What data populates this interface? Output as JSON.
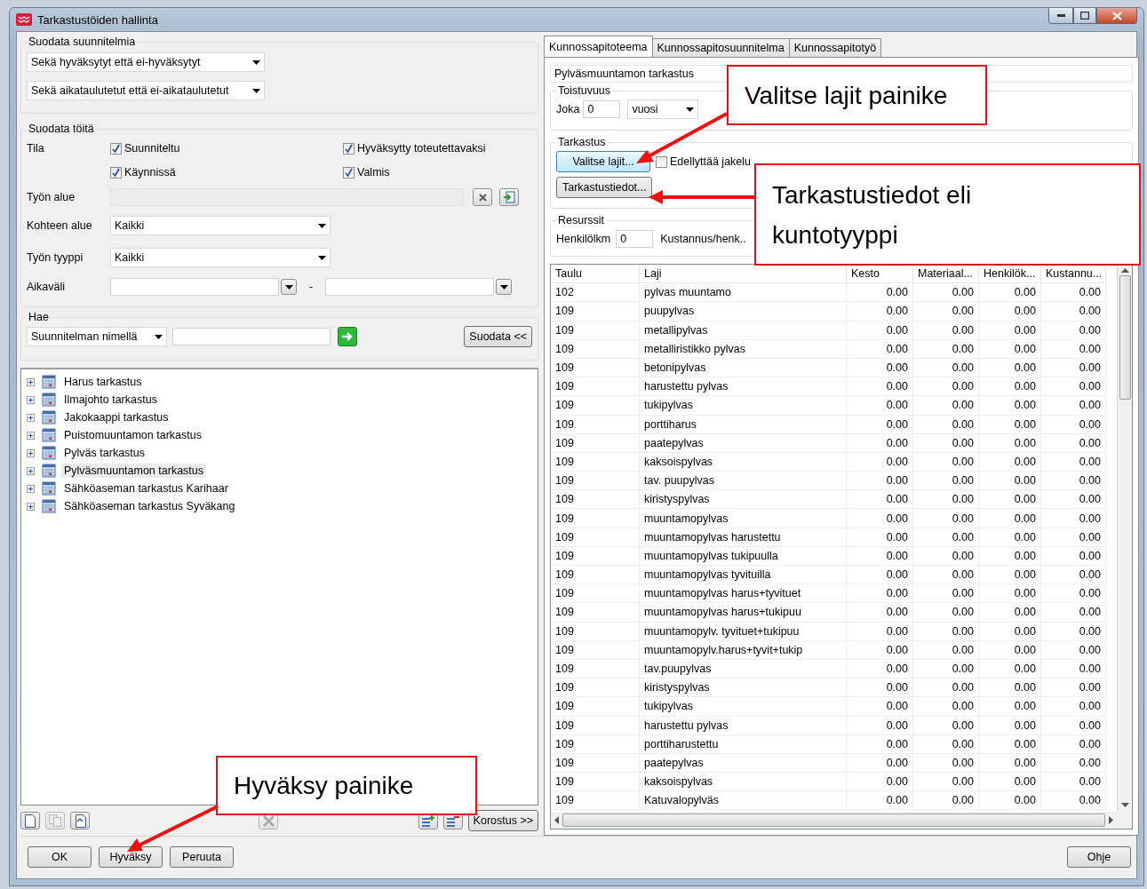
{
  "window": {
    "title": "Tarkastustöiden hallinta"
  },
  "plan_filter": {
    "title": "Suodata suunnitelmia",
    "approval": "Sekä hyväksytyt että ei-hyväksytyt",
    "schedule": "Sekä aikataulutetut että ei-aikataulutetut"
  },
  "work_filter": {
    "title": "Suodata töitä",
    "status_label": "Tila",
    "statuses": [
      {
        "label": "Suunniteltu",
        "checked": true
      },
      {
        "label": "Hyväksytty toteutettavaksi",
        "checked": true
      },
      {
        "label": "Käynnissä",
        "checked": true
      },
      {
        "label": "Valmis",
        "checked": true
      }
    ],
    "area_label": "Työn alue",
    "target_area_label": "Kohteen alue",
    "target_area": "Kaikki",
    "type_label": "Työn tyyppi",
    "type": "Kaikki",
    "period_label": "Aikaväli",
    "period_separator": "-"
  },
  "search": {
    "title": "Hae",
    "mode": "Suunnitelman nimellä",
    "filter_button": "Suodata <<"
  },
  "tree": [
    {
      "label": "Harus tarkastus",
      "selected": false,
      "expanded": false
    },
    {
      "label": "Ilmajohto tarkastus",
      "selected": false,
      "expanded": false
    },
    {
      "label": "Jakokaappi tarkastus",
      "selected": false,
      "expanded": false
    },
    {
      "label": "Puistomuuntamon tarkastus",
      "selected": false,
      "expanded": false
    },
    {
      "label": "Pylväs tarkastus",
      "selected": false,
      "expanded": false
    },
    {
      "label": "Pylväsmuuntamon tarkastus",
      "selected": true,
      "expanded": false
    },
    {
      "label": "Sähköaseman tarkastus Karihaar",
      "selected": false,
      "expanded": false
    },
    {
      "label": "Sähköaseman tarkastus Syväkang",
      "selected": false,
      "expanded": false
    }
  ],
  "toolbar": {
    "highlight_button": "Korostus >>"
  },
  "tabs": [
    {
      "label": "Kunnossapitoteema",
      "selected": true
    },
    {
      "label": "Kunnossapitosuunnitelma",
      "selected": false
    },
    {
      "label": "Kunnossapitotyö",
      "selected": false
    }
  ],
  "theme": {
    "name": "Pylväsmuuntamon tarkastus",
    "recurrence": {
      "title": "Toistuvuus",
      "every_label": "Joka",
      "every": "0",
      "unit": "vuosi"
    },
    "inspection": {
      "title": "Tarkastus",
      "buttons": [
        {
          "label": "Valitse lajit...",
          "focused": true
        },
        {
          "label": "Tarkastustiedot...",
          "focused": false
        }
      ],
      "checkbox": {
        "label": "Edellyttää jakelu",
        "checked": false
      }
    },
    "resources": {
      "title": "Resurssit",
      "persons_label": "Henkilölkm",
      "persons": "0",
      "cost_label": "Kustannus/henk.."
    }
  },
  "table": {
    "columns": [
      "Taulu",
      "Laji",
      "Kesto",
      "Materiaal...",
      "Henkilök...",
      "Kustannu..."
    ],
    "rows": [
      [
        "102",
        "pylvas muuntamo",
        "0.00",
        "0.00",
        "0.00",
        "0.00"
      ],
      [
        "109",
        "puupylvas",
        "0.00",
        "0.00",
        "0.00",
        "0.00"
      ],
      [
        "109",
        "metallipylvas",
        "0.00",
        "0.00",
        "0.00",
        "0.00"
      ],
      [
        "109",
        "metalliristikko pylvas",
        "0.00",
        "0.00",
        "0.00",
        "0.00"
      ],
      [
        "109",
        "betonipylvas",
        "0.00",
        "0.00",
        "0.00",
        "0.00"
      ],
      [
        "109",
        "harustettu pylvas",
        "0.00",
        "0.00",
        "0.00",
        "0.00"
      ],
      [
        "109",
        "tukipylvas",
        "0.00",
        "0.00",
        "0.00",
        "0.00"
      ],
      [
        "109",
        "porttiharus",
        "0.00",
        "0.00",
        "0.00",
        "0.00"
      ],
      [
        "109",
        "paatepylvas",
        "0.00",
        "0.00",
        "0.00",
        "0.00"
      ],
      [
        "109",
        "kaksoispylvas",
        "0.00",
        "0.00",
        "0.00",
        "0.00"
      ],
      [
        "109",
        "tav. puupylvas",
        "0.00",
        "0.00",
        "0.00",
        "0.00"
      ],
      [
        "109",
        "kiristyspylvas",
        "0.00",
        "0.00",
        "0.00",
        "0.00"
      ],
      [
        "109",
        "muuntamopylvas",
        "0.00",
        "0.00",
        "0.00",
        "0.00"
      ],
      [
        "109",
        "muuntamopylvas harustettu",
        "0.00",
        "0.00",
        "0.00",
        "0.00"
      ],
      [
        "109",
        "muuntamopylvas tukipuulla",
        "0.00",
        "0.00",
        "0.00",
        "0.00"
      ],
      [
        "109",
        "muuntamopylvas tyvituilla",
        "0.00",
        "0.00",
        "0.00",
        "0.00"
      ],
      [
        "109",
        "muuntamopylvas harus+tyvituet",
        "0.00",
        "0.00",
        "0.00",
        "0.00"
      ],
      [
        "109",
        "muuntamopylvas harus+tukipuu",
        "0.00",
        "0.00",
        "0.00",
        "0.00"
      ],
      [
        "109",
        "muuntamopylv. tyvituet+tukipuu",
        "0.00",
        "0.00",
        "0.00",
        "0.00"
      ],
      [
        "109",
        "muuntamopylv.harus+tyvit+tukip",
        "0.00",
        "0.00",
        "0.00",
        "0.00"
      ],
      [
        "109",
        "tav.puupylvas",
        "0.00",
        "0.00",
        "0.00",
        "0.00"
      ],
      [
        "109",
        "kiristyspylvas",
        "0.00",
        "0.00",
        "0.00",
        "0.00"
      ],
      [
        "109",
        "tukipylvas",
        "0.00",
        "0.00",
        "0.00",
        "0.00"
      ],
      [
        "109",
        "harustettu pylvas",
        "0.00",
        "0.00",
        "0.00",
        "0.00"
      ],
      [
        "109",
        "porttiharustettu",
        "0.00",
        "0.00",
        "0.00",
        "0.00"
      ],
      [
        "109",
        "paatepylvas",
        "0.00",
        "0.00",
        "0.00",
        "0.00"
      ],
      [
        "109",
        "kaksoispylvas",
        "0.00",
        "0.00",
        "0.00",
        "0.00"
      ],
      [
        "109",
        "Katuvalopylväs",
        "0.00",
        "0.00",
        "0.00",
        "0.00"
      ]
    ]
  },
  "buttons": [
    "OK",
    "Hyväksy",
    "Peruuta"
  ],
  "help_button": "Ohje",
  "annotations": [
    {
      "text": "Valitse lajit painike"
    },
    {
      "text": "Tarkastustiedot eli kuntotyyppi"
    },
    {
      "text": "Hyväksy painike"
    }
  ]
}
